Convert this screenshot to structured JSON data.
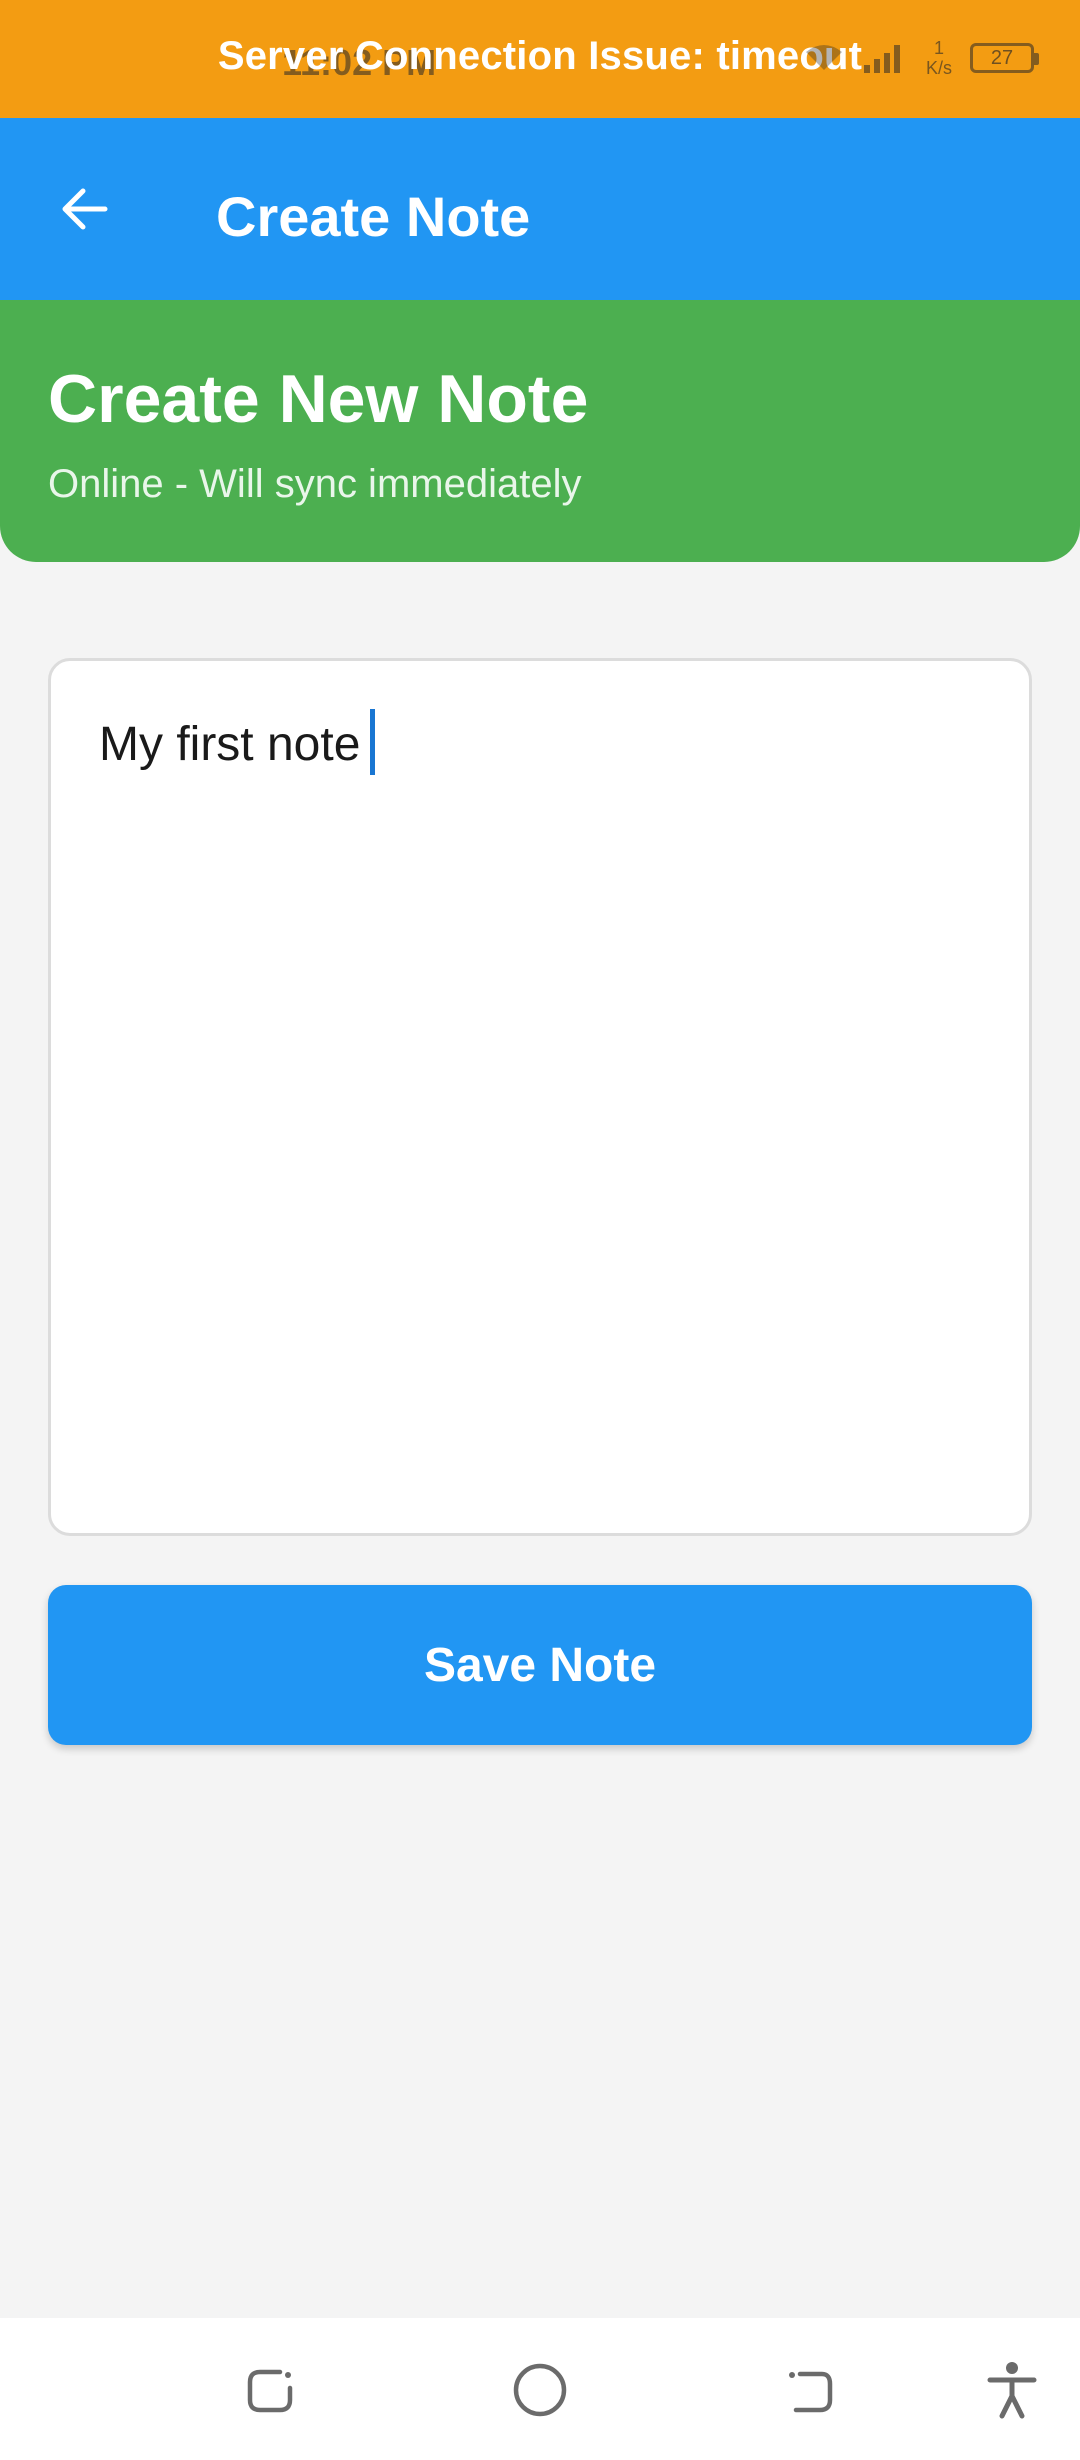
{
  "status_bar": {
    "banner": "Server Connection Issue: timeout",
    "time": "11:02 PM",
    "network_speed": [
      "1",
      "K/s"
    ],
    "battery": "27"
  },
  "app_bar": {
    "title": "Create Note",
    "back_icon": "arrow-back-icon"
  },
  "header": {
    "title": "Create New Note",
    "subtitle": "Online - Will sync immediately"
  },
  "note": {
    "value": "My first note"
  },
  "actions": {
    "save_label": "Save Note"
  },
  "nav_bar": {
    "icons": [
      "recents-icon",
      "home-icon",
      "back-icon",
      "accessibility-icon"
    ]
  },
  "colors": {
    "banner": "#f39c12",
    "app_bar": "#2196f3",
    "header": "#4caf50",
    "button": "#2196f3",
    "background": "#f4f4f4"
  }
}
